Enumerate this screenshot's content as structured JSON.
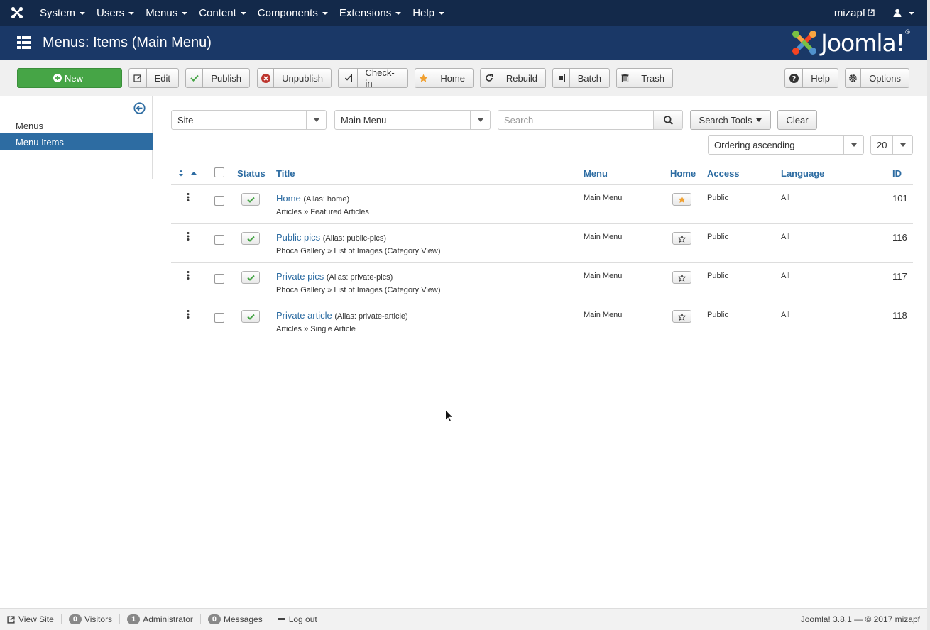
{
  "navbar": {
    "menu": [
      "System",
      "Users",
      "Menus",
      "Content",
      "Components",
      "Extensions",
      "Help"
    ],
    "user_link": "mizapf"
  },
  "header": {
    "title": "Menus: Items (Main Menu)",
    "logo_text": "Joomla!"
  },
  "toolbar": {
    "new": "New",
    "edit": "Edit",
    "publish": "Publish",
    "unpublish": "Unpublish",
    "checkin": "Check-in",
    "home": "Home",
    "rebuild": "Rebuild",
    "batch": "Batch",
    "trash": "Trash",
    "help": "Help",
    "options": "Options"
  },
  "sidebar": {
    "items": [
      "Menus",
      "Menu Items"
    ],
    "active": "Menu Items"
  },
  "filters": {
    "client": "Site",
    "menu": "Main Menu",
    "search_placeholder": "Search",
    "search_tools": "Search Tools",
    "clear": "Clear",
    "ordering": "Ordering ascending",
    "limit": "20"
  },
  "table": {
    "headers": {
      "status": "Status",
      "title": "Title",
      "menu": "Menu",
      "home": "Home",
      "access": "Access",
      "language": "Language",
      "id": "ID"
    },
    "rows": [
      {
        "title": "Home",
        "alias": "(Alias: home)",
        "type": "Articles » Featured Articles",
        "menu": "Main Menu",
        "home": true,
        "access": "Public",
        "language": "All",
        "id": "101"
      },
      {
        "title": "Public pics",
        "alias": "(Alias: public-pics)",
        "type": "Phoca Gallery » List of Images (Category View)",
        "menu": "Main Menu",
        "home": false,
        "access": "Public",
        "language": "All",
        "id": "116"
      },
      {
        "title": "Private pics",
        "alias": "(Alias: private-pics)",
        "type": "Phoca Gallery » List of Images (Category View)",
        "menu": "Main Menu",
        "home": false,
        "access": "Public",
        "language": "All",
        "id": "117"
      },
      {
        "title": "Private article",
        "alias": "(Alias: private-article)",
        "type": "Articles » Single Article",
        "menu": "Main Menu",
        "home": false,
        "access": "Public",
        "language": "All",
        "id": "118"
      }
    ]
  },
  "statusbar": {
    "view_site": "View Site",
    "visitors_count": "0",
    "visitors": "Visitors",
    "admin_count": "1",
    "admin": "Administrator",
    "messages_count": "0",
    "messages": "Messages",
    "logout": "Log out",
    "version": "Joomla! 3.8.1 — © 2017 mizapf"
  },
  "colors": {
    "navbar": "#13294a",
    "header": "#1a3867",
    "new_button": "#46a546",
    "link": "#2d6ca2",
    "publish_check": "#46a546",
    "home_star": "#f0a030"
  }
}
